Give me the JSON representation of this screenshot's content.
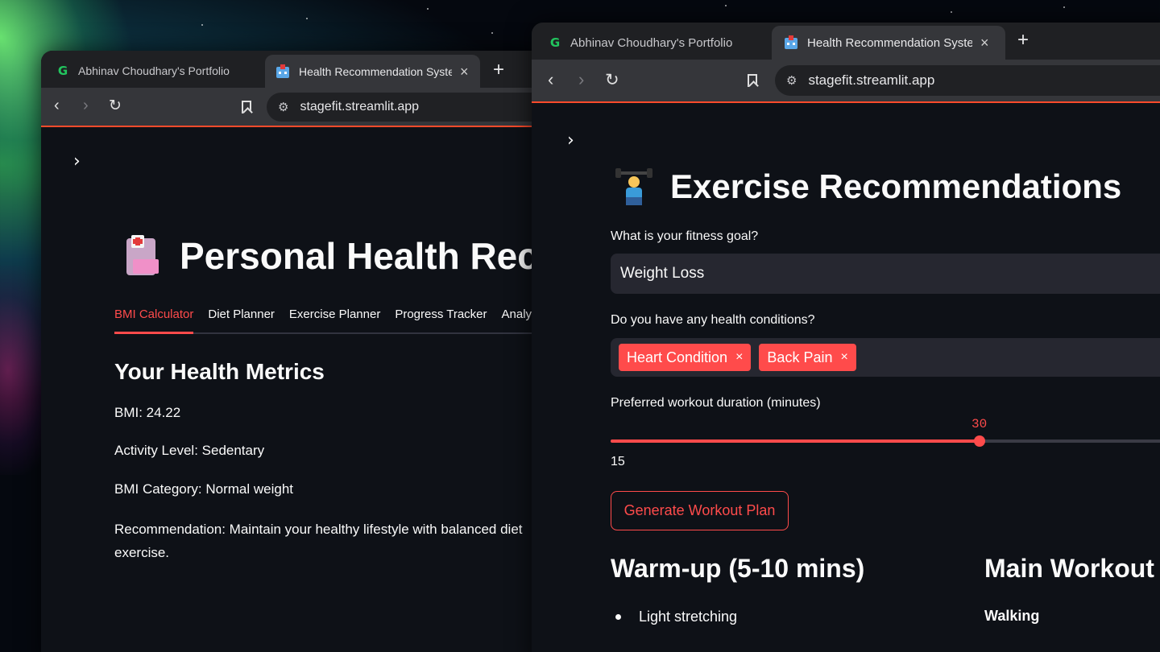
{
  "left_window": {
    "tabs": [
      {
        "title": "Abhinav Choudhary's Portfolio",
        "icon": "g-icon"
      },
      {
        "title": "Health Recommendation Syster",
        "icon": "hospital-icon"
      }
    ],
    "new_tab": "+",
    "close": "×",
    "url": "stagefit.streamlit.app",
    "page_title": "Personal Health Rec",
    "nav_tabs": [
      "BMI Calculator",
      "Diet Planner",
      "Exercise Planner",
      "Progress Tracker",
      "Analyti"
    ],
    "active_tab": "BMI Calculator",
    "section_heading": "Your Health Metrics",
    "metrics": {
      "bmi": "BMI: 24.22",
      "activity": "Activity Level: Sedentary",
      "category": "BMI Category: Normal weight"
    },
    "recommendation": "Recommendation: Maintain your healthy lifestyle with balanced diet exercise."
  },
  "right_window": {
    "tabs": [
      {
        "title": "Abhinav Choudhary's Portfolio",
        "icon": "g-icon"
      },
      {
        "title": "Health Recommendation Syster",
        "icon": "hospital-icon"
      }
    ],
    "new_tab": "+",
    "close": "×",
    "url": "stagefit.streamlit.app",
    "page_title": "Exercise Recommendations",
    "goal_label": "What is your fitness goal?",
    "goal_value": "Weight Loss",
    "conditions_label": "Do you have any health conditions?",
    "conditions": [
      "Heart Condition",
      "Back Pain"
    ],
    "chip_remove": "×",
    "duration_label": "Preferred workout duration (minutes)",
    "duration_value": "30",
    "duration_value_num": 30,
    "duration_min": "15",
    "duration_fill_fraction": 0.636,
    "generate_button": "Generate Workout Plan",
    "warmup_heading": "Warm-up (5-10 mins)",
    "warmup_items": [
      "Light stretching"
    ],
    "main_heading": "Main Workout",
    "main_subheading": "Walking"
  },
  "colors": {
    "accent": "#ff4b4b",
    "address_underline": "#ff4b2b",
    "background": "#0e1117",
    "input_bg": "#262730"
  }
}
